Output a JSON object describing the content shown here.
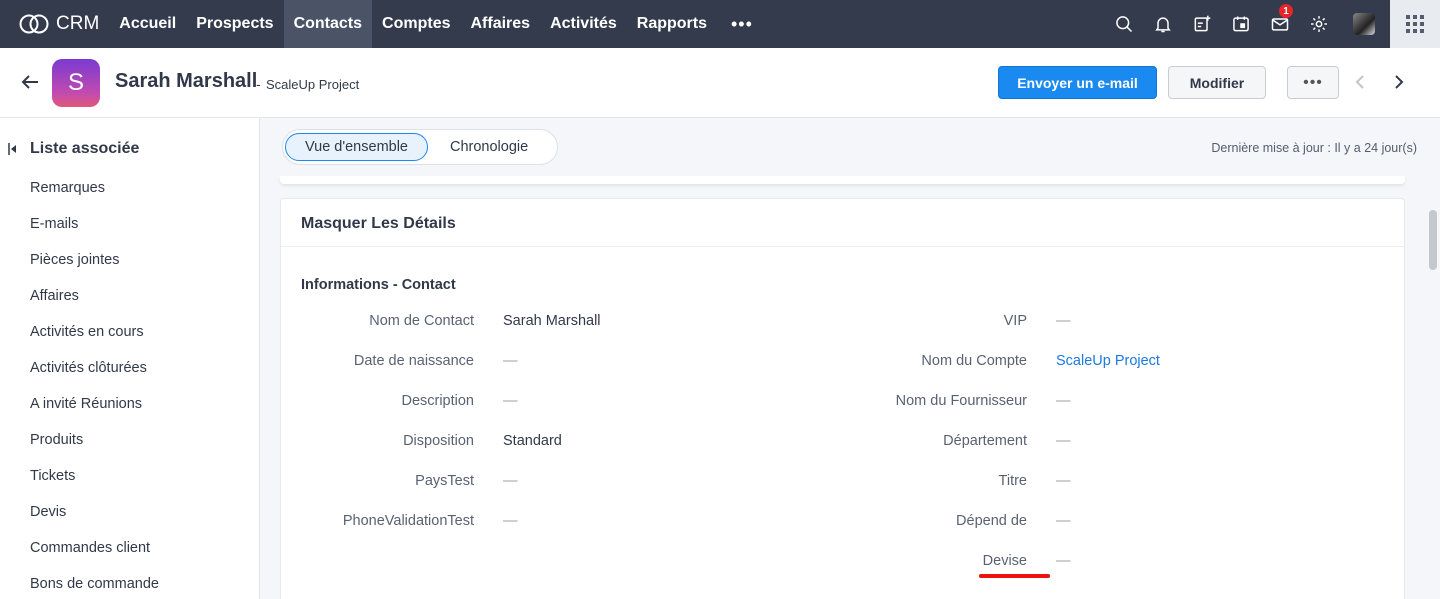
{
  "app": {
    "name": "CRM"
  },
  "nav": {
    "items": [
      {
        "label": "Accueil",
        "active": false
      },
      {
        "label": "Prospects",
        "active": false
      },
      {
        "label": "Contacts",
        "active": true
      },
      {
        "label": "Comptes",
        "active": false
      },
      {
        "label": "Affaires",
        "active": false
      },
      {
        "label": "Activités",
        "active": false
      },
      {
        "label": "Rapports",
        "active": false
      }
    ],
    "more": "•••",
    "mail_badge": "1"
  },
  "header": {
    "avatar_letter": "S",
    "name": "Sarah Marshall",
    "separator": "-",
    "account": "ScaleUp Project",
    "send_email": "Envoyer un e-mail",
    "edit": "Modifier",
    "more": "•••"
  },
  "sidebar": {
    "title": "Liste associée",
    "items": [
      "Remarques",
      "E-mails",
      "Pièces jointes",
      "Affaires",
      "Activités en cours",
      "Activités clôturées",
      "A invité Réunions",
      "Produits",
      "Tickets",
      "Devis",
      "Commandes client",
      "Bons de commande"
    ]
  },
  "tabs": {
    "overview": "Vue d'ensemble",
    "timeline": "Chronologie",
    "last_update": "Dernière mise à jour : Il y a 24 jour(s)"
  },
  "details": {
    "card_title": "Masquer Les Détails",
    "section_title": "Informations - Contact",
    "left": [
      {
        "label": "Nom de Contact",
        "value": "Sarah Marshall"
      },
      {
        "label": "Date de naissance",
        "value": "—"
      },
      {
        "label": "Description",
        "value": "—"
      },
      {
        "label": "Disposition",
        "value": "Standard"
      },
      {
        "label": "PaysTest",
        "value": "—"
      },
      {
        "label": "PhoneValidationTest",
        "value": "—"
      }
    ],
    "right": [
      {
        "label": "VIP",
        "value": "—"
      },
      {
        "label": "Nom du Compte",
        "value": "ScaleUp Project"
      },
      {
        "label": "Nom du Fournisseur",
        "value": "—"
      },
      {
        "label": "Département",
        "value": "—"
      },
      {
        "label": "Titre",
        "value": "—"
      },
      {
        "label": "Dépend de",
        "value": "—"
      },
      {
        "label": "Devise",
        "value": "—"
      }
    ]
  },
  "colors": {
    "topnav": "#333b4c",
    "primary": "#1a8af0",
    "link": "#1a7ae0",
    "highlight": "#e11111"
  }
}
